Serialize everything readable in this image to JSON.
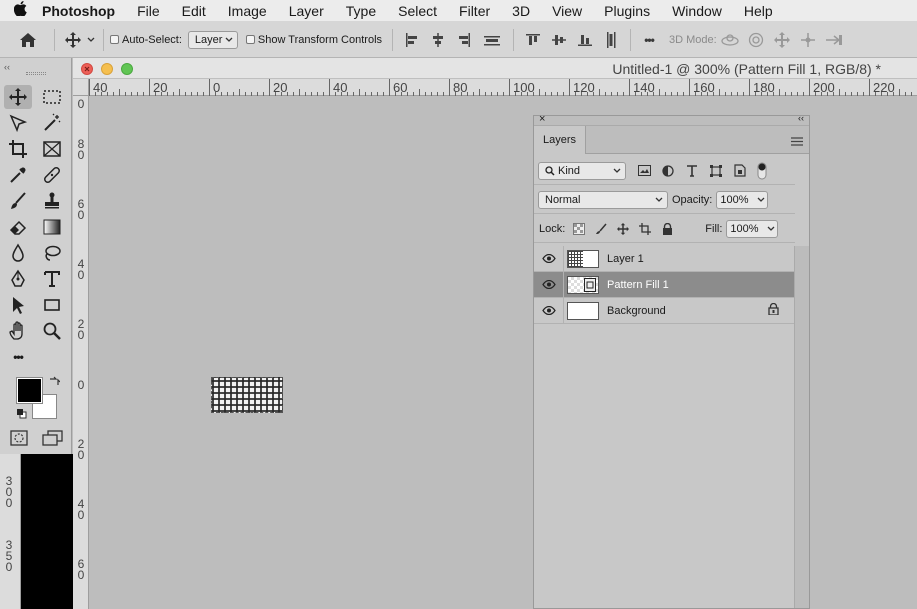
{
  "menubar": {
    "apple": "",
    "items": [
      "Photoshop",
      "File",
      "Edit",
      "Image",
      "Layer",
      "Type",
      "Select",
      "Filter",
      "3D",
      "View",
      "Plugins",
      "Window",
      "Help"
    ]
  },
  "options": {
    "auto_select_label": "Auto-Select:",
    "auto_select_value": "Layer",
    "show_transform_label": "Show Transform Controls",
    "three_d_mode_label": "3D Mode:",
    "more": "•••"
  },
  "document": {
    "title": "Untitled-1 @ 300% (Pattern Fill 1, RGB/8) *"
  },
  "ruler": {
    "h_labels": [
      "40",
      "20",
      "0",
      "20",
      "40",
      "60",
      "80",
      "100",
      "120",
      "140",
      "160",
      "180",
      "200",
      "220"
    ],
    "v_labels": [
      "0",
      "8\n0",
      "6\n0",
      "4\n0",
      "2\n0",
      "0",
      "2\n0",
      "4\n0",
      "6\n0"
    ],
    "v_labels_lower": [
      "3\n0\n0",
      "3\n5\n0"
    ]
  },
  "toolbar": {
    "collapse": "‹‹",
    "more_tools": "•••"
  },
  "colors": {
    "foreground": "#000000",
    "background": "#ffffff"
  },
  "layers_panel": {
    "close": "×",
    "collapse": "‹‹",
    "tab_label": "Layers",
    "kind_label": "Kind",
    "blend_mode": "Normal",
    "opacity_label": "Opacity:",
    "opacity_value": "100%",
    "lock_label": "Lock:",
    "fill_label": "Fill:",
    "fill_value": "100%",
    "layers": [
      {
        "name": "Layer 1",
        "selected": false,
        "locked": false
      },
      {
        "name": "Pattern Fill 1",
        "selected": true,
        "locked": false
      },
      {
        "name": "Background",
        "selected": false,
        "locked": true
      }
    ]
  }
}
